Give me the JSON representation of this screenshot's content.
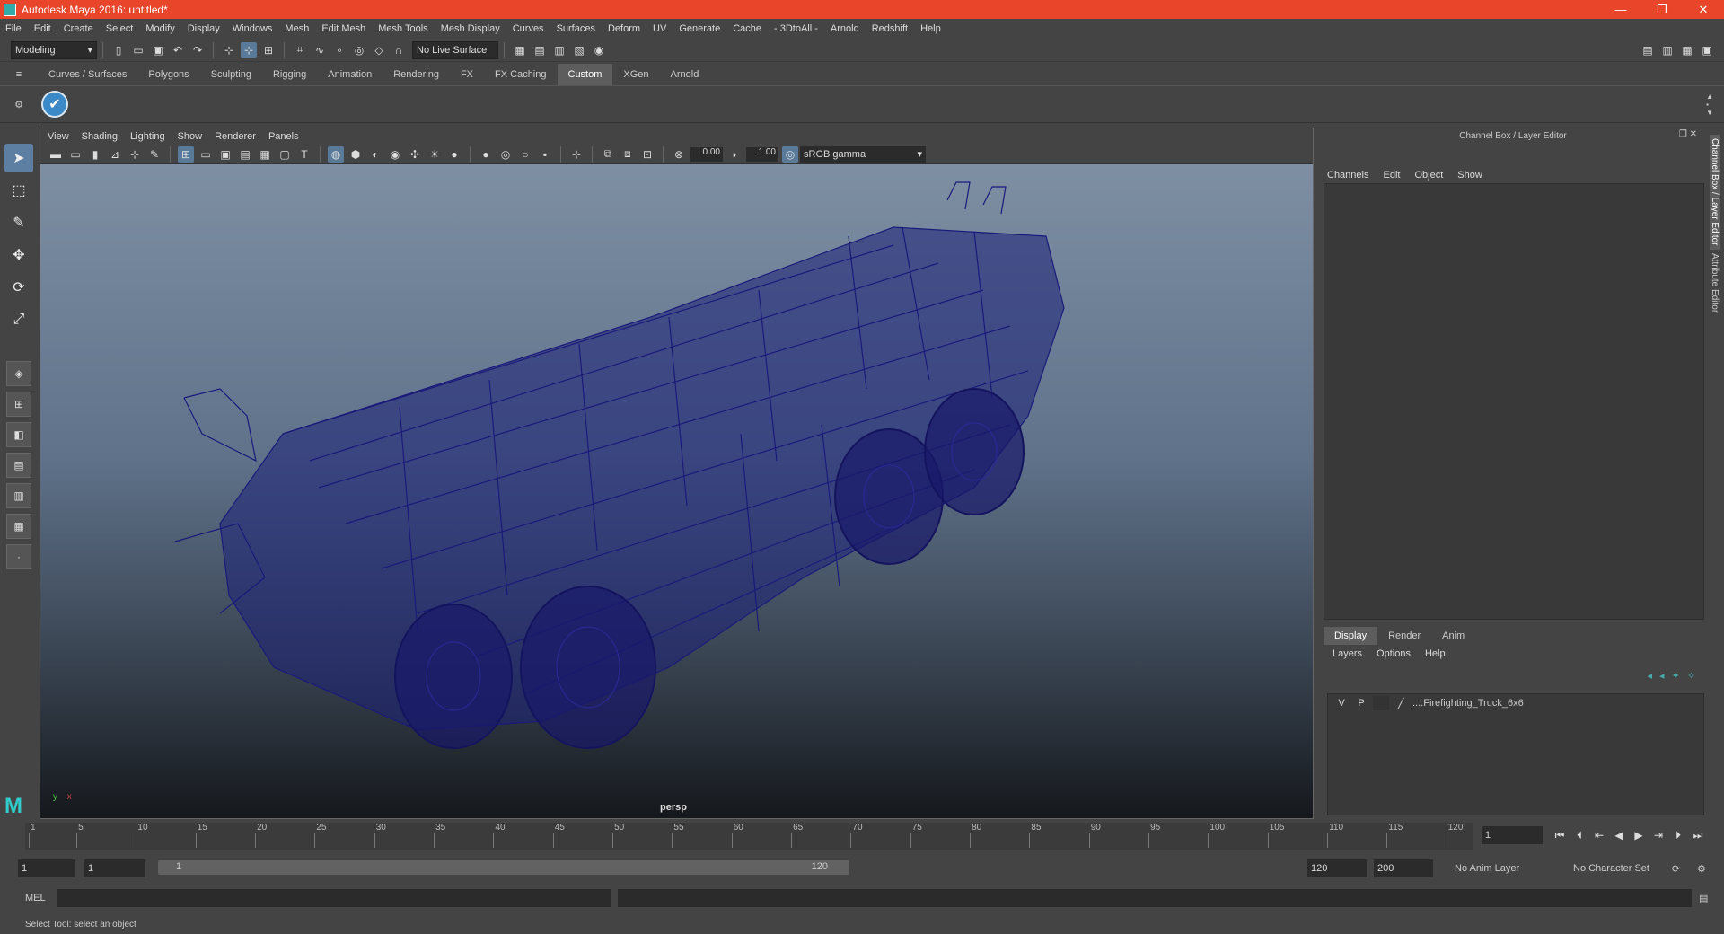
{
  "window": {
    "title": "Autodesk Maya 2016: untitled*",
    "minimize": "—",
    "restore": "❐",
    "close": "✕"
  },
  "menubar": [
    "File",
    "Edit",
    "Create",
    "Select",
    "Modify",
    "Display",
    "Windows",
    "Mesh",
    "Edit Mesh",
    "Mesh Tools",
    "Mesh Display",
    "Curves",
    "Surfaces",
    "Deform",
    "UV",
    "Generate",
    "Cache",
    "- 3DtoAll -",
    "Arnold",
    "Redshift",
    "Help"
  ],
  "statusline": {
    "mode": "Modeling",
    "live_surface": "No Live Surface"
  },
  "shelf": {
    "tabs": [
      "Curves / Surfaces",
      "Polygons",
      "Sculpting",
      "Rigging",
      "Animation",
      "Rendering",
      "FX",
      "FX Caching",
      "Custom",
      "XGen",
      "Arnold"
    ],
    "active_tab": "Custom"
  },
  "viewport": {
    "menu": [
      "View",
      "Shading",
      "Lighting",
      "Show",
      "Renderer",
      "Panels"
    ],
    "exposure": "0.00",
    "gamma": "1.00",
    "color_space": "sRGB gamma",
    "camera": "persp"
  },
  "channelbox": {
    "title": "Channel Box / Layer Editor",
    "menu": [
      "Channels",
      "Edit",
      "Object",
      "Show"
    ]
  },
  "layer_editor": {
    "tabs": [
      "Display",
      "Render",
      "Anim"
    ],
    "active_tab": "Display",
    "menu": [
      "Layers",
      "Options",
      "Help"
    ],
    "layers": [
      {
        "v": "V",
        "p": "P",
        "name": "...:Firefighting_Truck_6x6"
      }
    ]
  },
  "side_tabs": [
    "Channel Box / Layer Editor",
    "Attribute Editor"
  ],
  "timeline": {
    "ticks": [
      "1",
      "5",
      "10",
      "15",
      "20",
      "25",
      "30",
      "35",
      "40",
      "45",
      "50",
      "55",
      "60",
      "65",
      "70",
      "75",
      "80",
      "85",
      "90",
      "95",
      "100",
      "105",
      "110",
      "115",
      "120"
    ],
    "current_frame": "1"
  },
  "range": {
    "start": "1",
    "playback_start": "1",
    "slider_start": "1",
    "slider_end": "120",
    "playback_end": "120",
    "end": "200",
    "anim_layer": "No Anim Layer",
    "character_set": "No Character Set"
  },
  "commandline": {
    "label": "MEL"
  },
  "helpline": {
    "text": "Select Tool: select an object"
  }
}
